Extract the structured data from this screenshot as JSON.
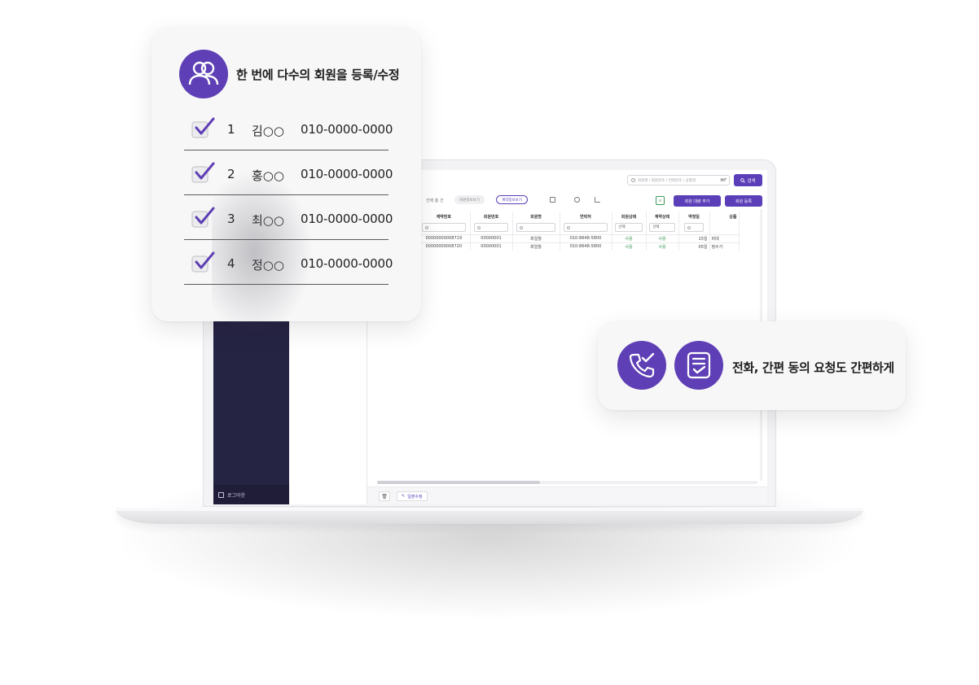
{
  "app": {
    "search": {
      "placeholder": "회원명 / 회원번호 / 전화번호 / 상품명",
      "kbd": "⌘F",
      "button_label": "검색"
    },
    "toolbar": {
      "selected_count": "선택 총 건",
      "pill_member": "회원정보보기",
      "pill_contract": "계약정보보기",
      "add_target_button": "회원 대량 추가",
      "register_button": "회원 등록"
    },
    "table": {
      "headers": [
        "계약번호",
        "회원번호",
        "회원명",
        "연락처",
        "회원상태",
        "계약상태",
        "약정일",
        "상품"
      ],
      "filter_select": "선택",
      "rows": [
        {
          "contract_no": "00000000008719",
          "member_no": "00000001",
          "name": "최일월",
          "phone": "010-8648-5800",
          "member_status": "사용",
          "contract_status": "사용",
          "due_day": "15일",
          "product": "비데"
        },
        {
          "contract_no": "00000000008720",
          "member_no": "00000001",
          "name": "최일월",
          "phone": "010-8648-5800",
          "member_status": "사용",
          "contract_status": "사용",
          "due_day": "05일",
          "product": "정수기"
        }
      ]
    },
    "bottom": {
      "bulk_edit": "일괄수정"
    },
    "sidebar": {
      "logout": "로그아웃"
    }
  },
  "card_bulk": {
    "title": "한 번에 다수의 회원을 등록/수정",
    "members": [
      {
        "num": "1",
        "name": "김○○",
        "phone": "010-0000-0000"
      },
      {
        "num": "2",
        "name": "홍○○",
        "phone": "010-0000-0000"
      },
      {
        "num": "3",
        "name": "최○○",
        "phone": "010-0000-0000"
      },
      {
        "num": "4",
        "name": "정○○",
        "phone": "010-0000-0000"
      }
    ]
  },
  "card_request": {
    "text": "전화, 간편 동의 요청도 간편하게"
  },
  "colors": {
    "accent": "#5e3fb5",
    "sidebar": "#262443",
    "status_green": "#3f9a5a"
  },
  "icons": [
    "users-icon",
    "check-icon",
    "phone-check-icon",
    "document-check-icon",
    "search-icon",
    "logout-icon",
    "trash-icon",
    "edit-icon",
    "excel-icon"
  ]
}
